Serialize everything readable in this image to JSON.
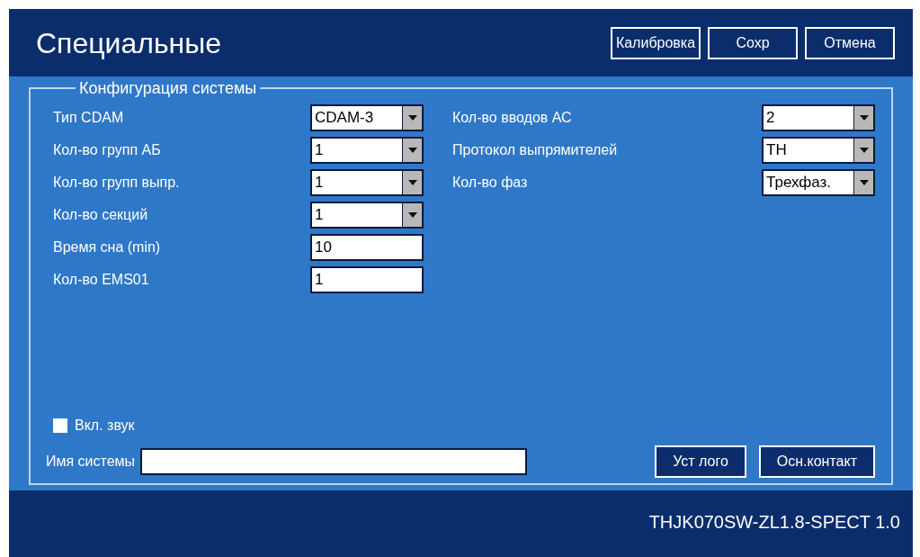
{
  "header": {
    "title": "Специальные",
    "buttons": [
      "Калибровка",
      "Сохр",
      "Отмена"
    ]
  },
  "group": {
    "title": "Конфигурация системы",
    "left_fields": [
      {
        "kind": "select",
        "label": "Тип CDAM",
        "value": "CDAM-3"
      },
      {
        "kind": "select",
        "label": "Кол-во групп АБ",
        "value": "1"
      },
      {
        "kind": "select",
        "label": "Кол-во групп выпр.",
        "value": "1"
      },
      {
        "kind": "select",
        "label": "Кол-во секций",
        "value": "1"
      },
      {
        "kind": "input",
        "label": "Время сна (min)",
        "value": "10"
      },
      {
        "kind": "input",
        "label": "Кол-во EMS01",
        "value": "1"
      }
    ],
    "right_fields": [
      {
        "kind": "select",
        "label": "Кол-во вводов АС",
        "value": "2"
      },
      {
        "kind": "select",
        "label": "Протокол выпрямителей",
        "value": "TH"
      },
      {
        "kind": "select",
        "label": "Кол-во фаз",
        "value": "Трехфаз."
      }
    ],
    "sound": {
      "label": "Вкл. звук",
      "checked": false
    },
    "system_name": {
      "label": "Имя системы"
    },
    "buttons": [
      "Уст лого",
      "Осн.контакт"
    ]
  },
  "footer": {
    "version": "THJK070SW-ZL1.8-SPECT 1.0"
  }
}
